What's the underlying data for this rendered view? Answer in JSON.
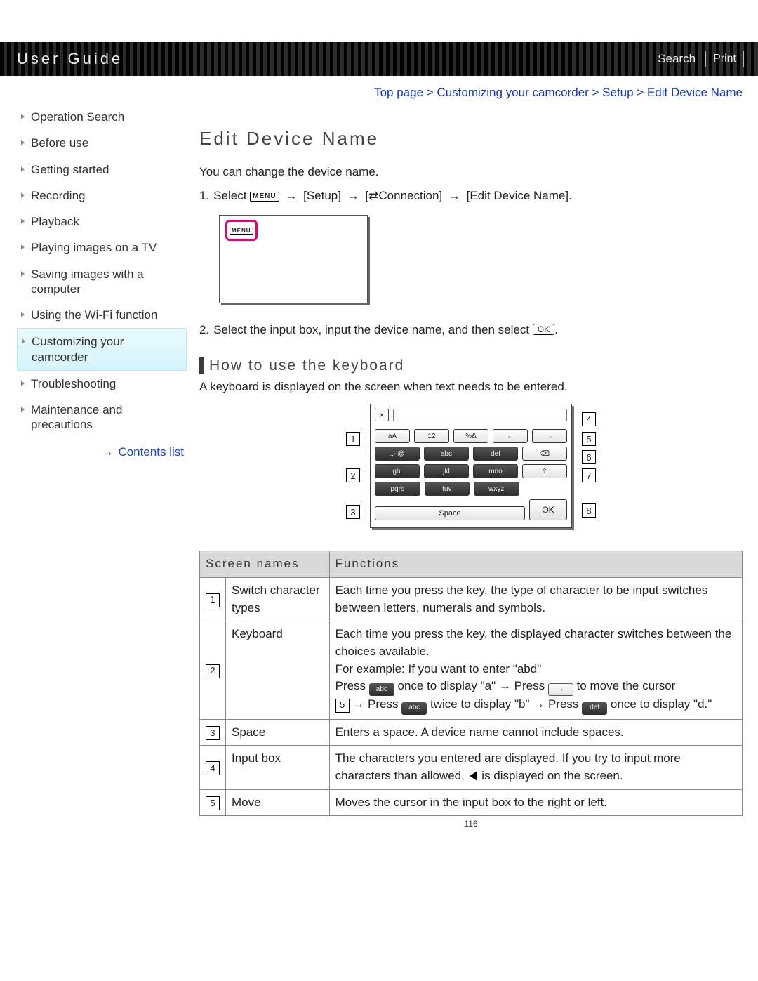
{
  "topbar": {
    "title": "User Guide",
    "search": "Search",
    "print": "Print"
  },
  "sidebar": {
    "items": [
      "Operation Search",
      "Before use",
      "Getting started",
      "Recording",
      "Playback",
      "Playing images on a TV",
      "Saving images with a computer",
      "Using the Wi-Fi function",
      "Customizing your camcorder",
      "Troubleshooting",
      "Maintenance and precautions"
    ],
    "active_index": 8,
    "contents_list": "Contents list"
  },
  "breadcrumb": "Top page > Customizing your camcorder > Setup > Edit Device Name",
  "page": {
    "title": "Edit Device Name",
    "intro": "You can change the device name.",
    "step1": {
      "num": "1.",
      "pre": "Select",
      "menu_chip": "MENU",
      "arrow": "→",
      "setup": "[Setup]",
      "swap_icon": "⇄",
      "connection": "Connection]",
      "edit": "[Edit Device Name]."
    },
    "step2": {
      "num": "2.",
      "text_a": "Select the input box, input the device name, and then select",
      "ok_chip": "OK",
      "text_b": "."
    },
    "sub_heading": "How to use the keyboard",
    "sub_desc": "A keyboard is displayed on the screen when text needs to be entered.",
    "keyboard": {
      "close": "×",
      "row_tabs": [
        "aA",
        "12",
        "%&"
      ],
      "arrows": [
        "←",
        "→"
      ],
      "keys_row2": [
        ".,-'@",
        "abc",
        "def"
      ],
      "backspace": "⌫",
      "keys_row3": [
        "ghi",
        "jkl",
        "mno"
      ],
      "shift": "⇧",
      "keys_row4": [
        "pqrs",
        "tuv",
        "wxyz"
      ],
      "space": "Space",
      "ok": "OK",
      "callouts": [
        "1",
        "2",
        "3",
        "4",
        "5",
        "6",
        "7",
        "8"
      ]
    },
    "table": {
      "head": [
        "Screen names",
        "Functions"
      ],
      "rows": [
        {
          "idx": "1",
          "name": "Switch character types",
          "func_plain": "Each time you press the key, the type of character to be input switches between letters, numerals and symbols."
        },
        {
          "idx": "2",
          "name": "Keyboard",
          "func_parts": {
            "l1": "Each time you press the key, the displayed character switches between the choices available.",
            "l2": "For example: If you want to enter \"abd\"",
            "press": "Press",
            "abc_chip": "abc",
            "once_a": "once to display \"a\"",
            "right_chip": "→",
            "move_cursor": "to move the cursor",
            "num5": "5",
            "press2": "Press",
            "twice_b": "twice to display \"b\"",
            "def_chip": "def",
            "once_d": "once to display \"d.\""
          }
        },
        {
          "idx": "3",
          "name": "Space",
          "func_plain": "Enters a space. A device name cannot include spaces."
        },
        {
          "idx": "4",
          "name": "Input box",
          "func_parts": {
            "a": "The characters you entered are displayed. If you try to input more characters than allowed, ",
            "b": " is displayed on the screen."
          }
        },
        {
          "idx": "5",
          "name": "Move",
          "func_plain": "Moves the cursor in the input box to the right or left."
        }
      ]
    },
    "pagenum": "116"
  }
}
